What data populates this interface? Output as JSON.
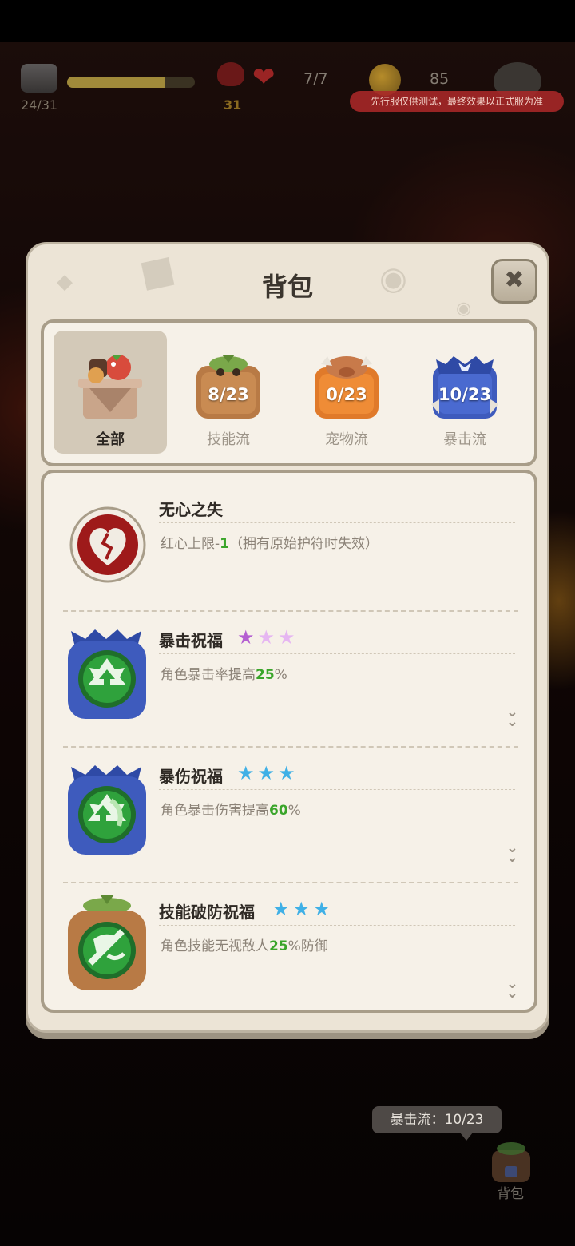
{
  "hud": {
    "xp_progress_text": "24/31",
    "xp_progress_fraction": 0.77,
    "demon_count": "31",
    "hearts_text": "7/7",
    "coins_text": "85",
    "test_banner": "先行服仅供测试，最终效果以正式服为准"
  },
  "modal": {
    "title": "背包",
    "close_icon": "close-icon"
  },
  "tabs": [
    {
      "label": "全部",
      "count": "",
      "active": true,
      "icon": "all-items-icon"
    },
    {
      "label": "技能流",
      "count": "8/23",
      "active": false,
      "icon": "skill-crate-icon"
    },
    {
      "label": "宠物流",
      "count": "0/23",
      "active": false,
      "icon": "pet-crate-icon"
    },
    {
      "label": "暴击流",
      "count": "10/23",
      "active": false,
      "icon": "crit-crate-icon"
    }
  ],
  "items": [
    {
      "title": "无心之失",
      "desc_pre": "红心上限-",
      "desc_hl": "1",
      "desc_post": "（拥有原始护符时失效）",
      "stars": 0,
      "star_color": "",
      "icon": "broken-heart-icon"
    },
    {
      "title": "暴击祝福",
      "desc_pre": "角色暴击率提高",
      "desc_hl": "25",
      "desc_post": "%",
      "stars": 3,
      "star_color": "#c07ad8",
      "icon": "crit-blessing-icon"
    },
    {
      "title": "暴伤祝福",
      "desc_pre": "角色暴击伤害提高",
      "desc_hl": "60",
      "desc_post": "%",
      "stars": 3,
      "star_color": "#4cb7ea",
      "icon": "crit-damage-blessing-icon"
    },
    {
      "title": "技能破防祝福",
      "desc_pre": "角色技能无视敌人",
      "desc_hl": "25",
      "desc_post": "%防御",
      "stars": 3,
      "star_color": "#4cb7ea",
      "icon": "skill-pierce-blessing-icon"
    }
  ],
  "tooltip": "暴击流：10/23",
  "bag_button": "背包"
}
